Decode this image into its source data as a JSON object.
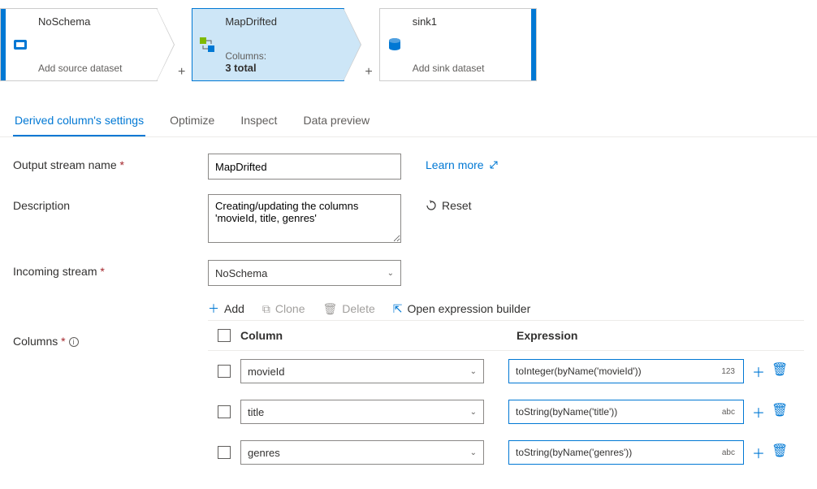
{
  "nodes": {
    "source": {
      "title": "NoSchema",
      "subtitle": "Add source dataset"
    },
    "derived": {
      "title": "MapDrifted",
      "sub1": "Columns:",
      "sub2": "3 total"
    },
    "sink": {
      "title": "sink1",
      "subtitle": "Add sink dataset"
    }
  },
  "tabs": {
    "settings": "Derived column's settings",
    "optimize": "Optimize",
    "inspect": "Inspect",
    "preview": "Data preview"
  },
  "form": {
    "outputStreamLabel": "Output stream name ",
    "outputStreamValue": "MapDrifted",
    "descriptionLabel": "Description",
    "descriptionValue": "Creating/updating the columns 'movieId, title, genres'",
    "incomingLabel": "Incoming stream ",
    "incomingValue": "NoSchema",
    "columnsLabel": "Columns ",
    "learnMore": "Learn more",
    "reset": "Reset"
  },
  "toolbar": {
    "add": "Add",
    "clone": "Clone",
    "delete": "Delete",
    "openExpr": "Open expression builder"
  },
  "table": {
    "colHeader": "Column",
    "exprHeader": "Expression",
    "rows": [
      {
        "name": "movieId",
        "expr": "toInteger(byName('movieId'))",
        "badge": "123"
      },
      {
        "name": "title",
        "expr": "toString(byName('title'))",
        "badge": "abc"
      },
      {
        "name": "genres",
        "expr": "toString(byName('genres'))",
        "badge": "abc"
      }
    ]
  }
}
